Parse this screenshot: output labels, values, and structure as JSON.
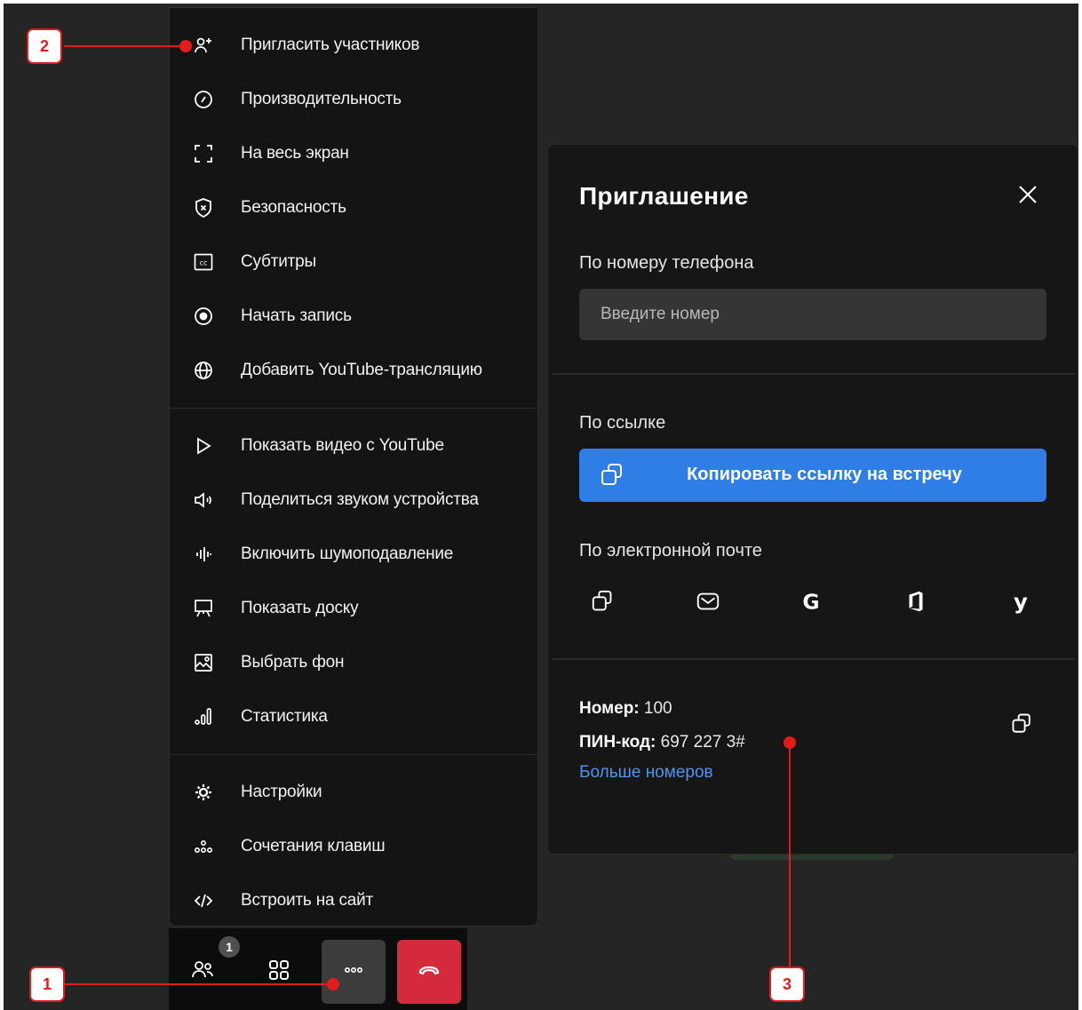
{
  "menu": {
    "items": [
      {
        "label": "Пригласить участников",
        "icon": "add-user-icon"
      },
      {
        "label": "Производительность",
        "icon": "gauge-icon"
      },
      {
        "label": "На весь экран",
        "icon": "fullscreen-icon"
      },
      {
        "label": "Безопасность",
        "icon": "shield-icon"
      },
      {
        "label": "Субтитры",
        "icon": "cc-icon"
      },
      {
        "label": "Начать запись",
        "icon": "record-icon"
      },
      {
        "label": "Добавить YouTube-трансляцию",
        "icon": "globe-icon"
      },
      {
        "label": "Показать видео с YouTube",
        "icon": "play-icon"
      },
      {
        "label": "Поделиться звуком устройства",
        "icon": "speaker-icon"
      },
      {
        "label": "Включить шумоподавление",
        "icon": "waveform-icon"
      },
      {
        "label": "Показать доску",
        "icon": "whiteboard-icon"
      },
      {
        "label": "Выбрать фон",
        "icon": "image-icon"
      },
      {
        "label": "Статистика",
        "icon": "stats-icon"
      },
      {
        "label": "Настройки",
        "icon": "gear-icon"
      },
      {
        "label": "Сочетания клавиш",
        "icon": "keyboard-shortcuts-icon"
      },
      {
        "label": "Встроить на сайт",
        "icon": "code-icon"
      }
    ]
  },
  "toolbar": {
    "participants_badge": "1",
    "buttons": [
      "participants-icon",
      "grid-icon",
      "more-icon",
      "hangup-icon"
    ],
    "hangup_color": "#d42a3c"
  },
  "invite": {
    "title": "Приглашение",
    "phone_label": "По номеру телефона",
    "phone_placeholder": "Введите номер",
    "link_label": "По ссылке",
    "copy_link_button": "Копировать ссылку на встречу",
    "email_label": "По электронной почте",
    "email_icons": [
      "copy-icon",
      "mail-icon",
      "google-icon",
      "office-icon",
      "yandex-icon"
    ],
    "number_label": "Номер:",
    "number_value": "100",
    "pin_label": "ПИН-код:",
    "pin_value": "697 227 3#",
    "more_numbers_link": "Больше номеров",
    "accent_color": "#2f7ee6"
  },
  "annotations": [
    "1",
    "2",
    "3"
  ],
  "annotation_color": "#e31b1b"
}
